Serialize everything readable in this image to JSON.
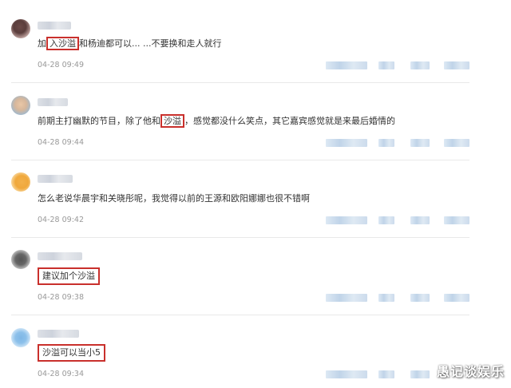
{
  "comments": [
    {
      "text_before": "加",
      "highlight": "入沙溢",
      "text_after": "和杨迪都可以... ...不要换和走人就行",
      "time": "04-28 09:49"
    },
    {
      "text_before": "前期主打幽默的节目，除了他和",
      "highlight": "沙溢",
      "text_after": "，感觉都没什么笑点，其它嘉宾感觉就是来最后婚情的",
      "time": "04-28 09:44"
    },
    {
      "text": "怎么老说华晨宇和关晓彤呢，我觉得以前的王源和欧阳娜娜也很不错啊",
      "time": "04-28 09:42"
    },
    {
      "highlight": "建议加个沙溢",
      "time": "04-28 09:38"
    },
    {
      "highlight": "沙溢可以当小5",
      "time": "04-28 09:34"
    }
  ],
  "watermark": "愚记谈娱乐",
  "colors": {
    "highlight_border": "#c9302c",
    "time": "#999999",
    "action_blur": "#b9cfe6"
  }
}
